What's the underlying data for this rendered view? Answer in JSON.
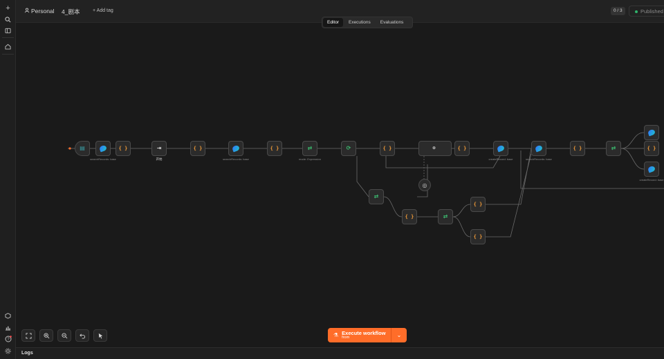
{
  "header": {
    "owner": "Personal",
    "workflow_name": "4_剧本",
    "add_tag": "+ Add tag",
    "counter": "0 / 3",
    "published": "Published"
  },
  "tabs": [
    {
      "label": "Editor",
      "active": true
    },
    {
      "label": "Executions",
      "active": false
    },
    {
      "label": "Evaluations",
      "active": false
    }
  ],
  "nodes": [
    {
      "id": "n1",
      "kind": "form",
      "label": "",
      "sub": ""
    },
    {
      "id": "n2",
      "kind": "feishu",
      "label": "",
      "sub": "searchRecords: base"
    },
    {
      "id": "n3",
      "kind": "code",
      "label": "",
      "sub": ""
    },
    {
      "id": "n4",
      "kind": "start",
      "label": "开始",
      "sub": ""
    },
    {
      "id": "n5",
      "kind": "code",
      "label": "",
      "sub": ""
    },
    {
      "id": "n6",
      "kind": "feishu",
      "label": "",
      "sub": "searchRecords: base"
    },
    {
      "id": "n7",
      "kind": "code",
      "label": "",
      "sub": ""
    },
    {
      "id": "n8",
      "kind": "if",
      "label": "",
      "sub": "mode: Expression"
    },
    {
      "id": "n9",
      "kind": "loop",
      "label": "",
      "sub": ""
    },
    {
      "id": "n10",
      "kind": "code",
      "label": "",
      "sub": ""
    },
    {
      "id": "n11",
      "kind": "ai",
      "label": "",
      "sub": ""
    },
    {
      "id": "n12",
      "kind": "code",
      "label": "",
      "sub": ""
    },
    {
      "id": "n13",
      "kind": "feishu",
      "label": "",
      "sub": "createRecord: base"
    },
    {
      "id": "n14",
      "kind": "feishu",
      "label": "",
      "sub": "searchRecords: base"
    },
    {
      "id": "n15",
      "kind": "code",
      "label": "",
      "sub": ""
    },
    {
      "id": "n16",
      "kind": "if",
      "label": "",
      "sub": ""
    },
    {
      "id": "n17",
      "kind": "feishu",
      "label": "",
      "sub": ""
    },
    {
      "id": "n18",
      "kind": "code",
      "label": "",
      "sub": ""
    },
    {
      "id": "n19",
      "kind": "feishu",
      "label": "",
      "sub": "createRecord: base"
    },
    {
      "id": "n20",
      "kind": "if",
      "label": "",
      "sub": ""
    },
    {
      "id": "n21",
      "kind": "code",
      "label": "",
      "sub": ""
    },
    {
      "id": "n22",
      "kind": "if",
      "label": "",
      "sub": ""
    },
    {
      "id": "n23",
      "kind": "code",
      "label": "",
      "sub": ""
    },
    {
      "id": "n24",
      "kind": "code",
      "label": "",
      "sub": ""
    }
  ],
  "ai_node": {
    "label": "",
    "model_label": ""
  },
  "execute": {
    "title": "Execute workflow",
    "from_prefix": "from",
    "from_node": ""
  },
  "logs_label": "Logs",
  "icons": {
    "rail": [
      "plus-icon",
      "search-icon",
      "sidebar-icon",
      "home-icon",
      "template-icon",
      "insights-icon",
      "help-icon",
      "settings-icon"
    ],
    "canvas_tools": [
      "fit-view-icon",
      "zoom-in-icon",
      "zoom-out-icon",
      "undo-icon",
      "pointer-icon"
    ]
  },
  "colors": {
    "accent": "#ff6d29",
    "success": "#2fb36b",
    "if_node": "#3cba6f",
    "code_node": "#f39c39"
  }
}
